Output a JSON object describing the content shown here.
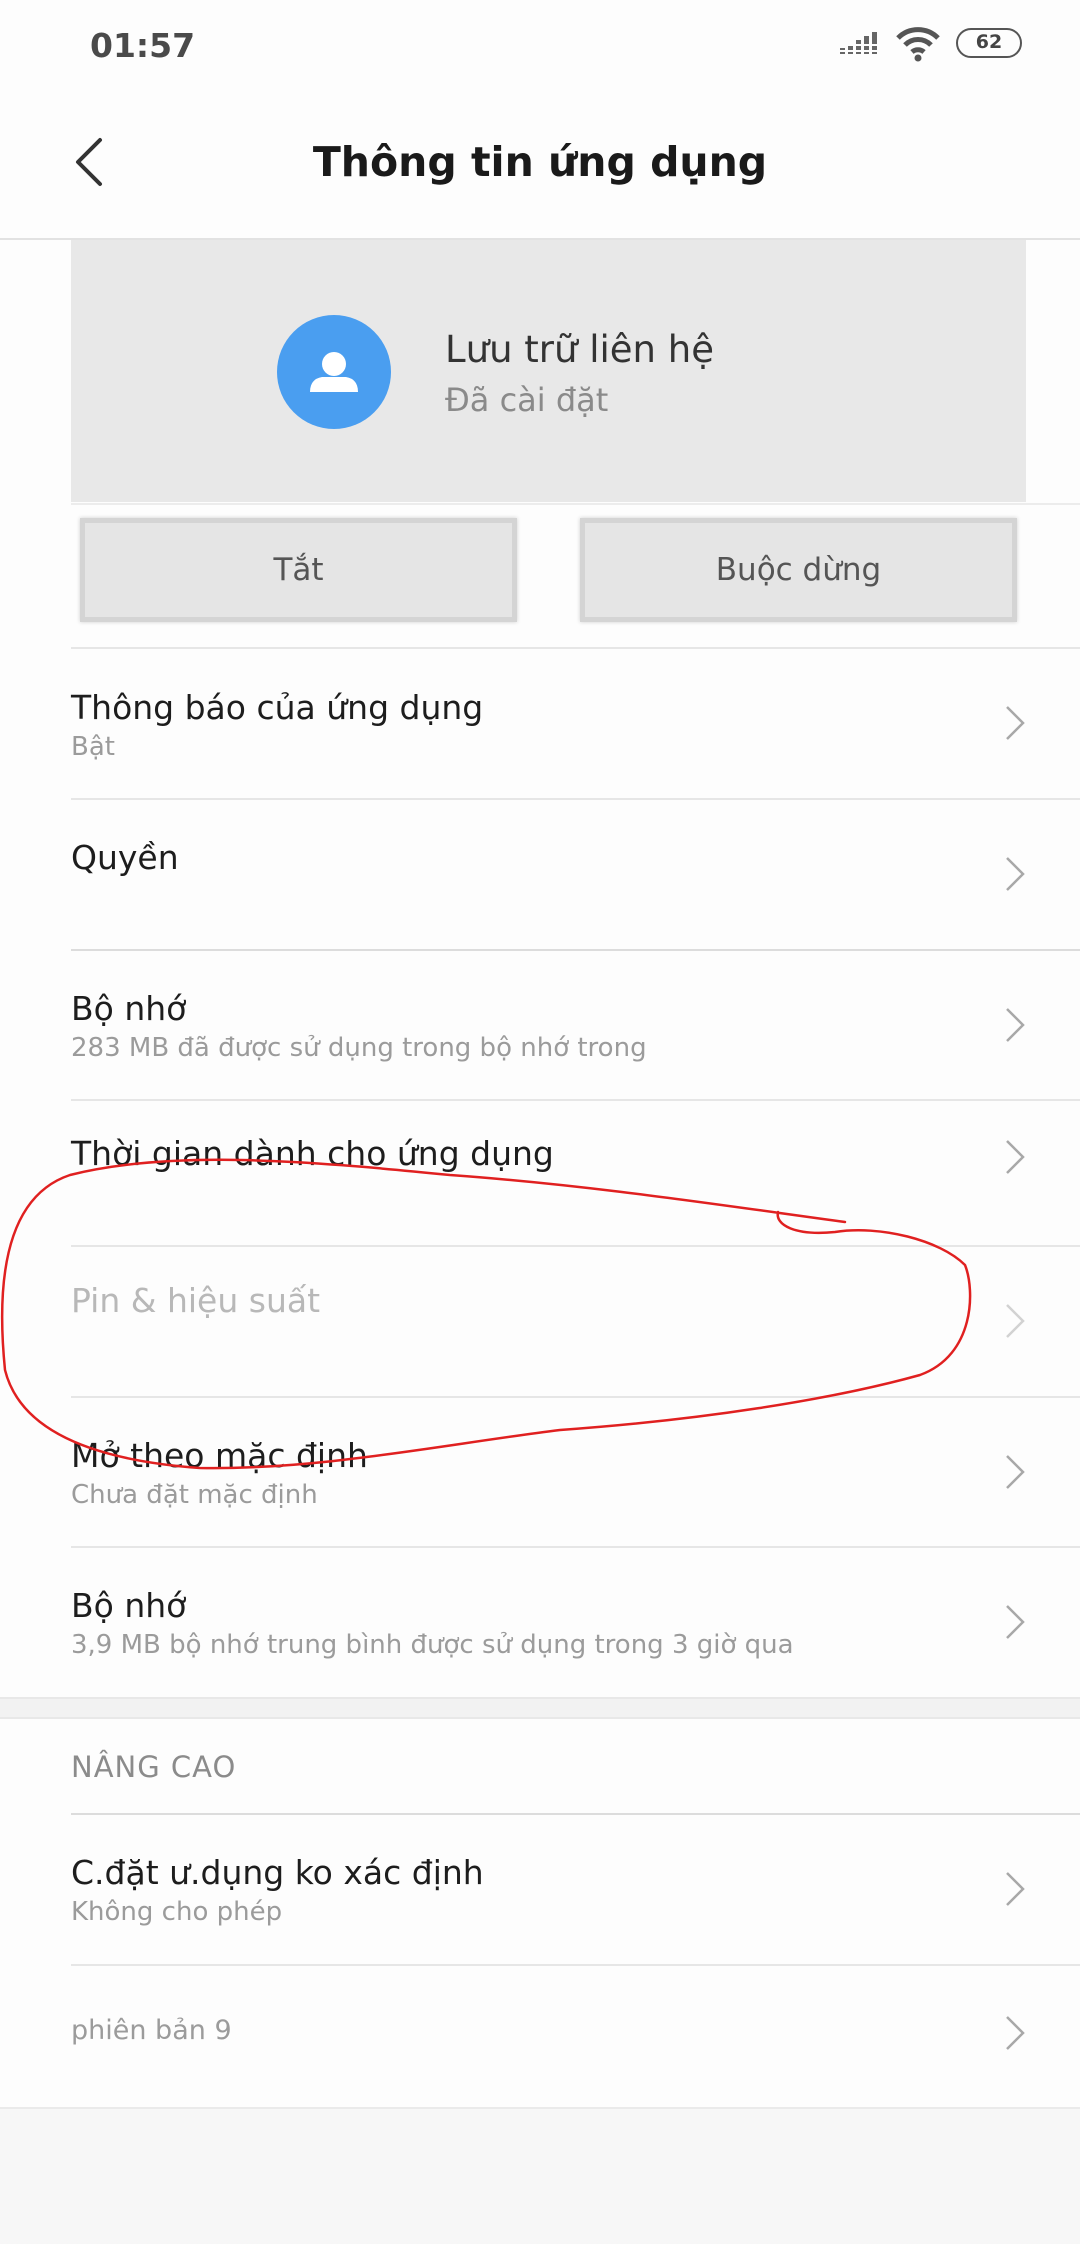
{
  "status_bar": {
    "time": "01:57",
    "battery": "62",
    "icons": [
      "signal-icon",
      "wifi-icon",
      "battery-icon"
    ]
  },
  "header": {
    "title": "Thông tin ứng dụng",
    "back_icon": "back-arrow-icon"
  },
  "app": {
    "name": "Lưu trữ liên hệ",
    "status": "Đã cài đặt",
    "icon": "contact-person-icon",
    "icon_color": "#4a9ef0"
  },
  "buttons": {
    "disable": "Tắt",
    "force_stop": "Buộc dừng"
  },
  "settings": [
    {
      "title": "Thông báo của ứng dụng",
      "subtitle": "Bật"
    },
    {
      "title": "Quyền",
      "subtitle": ""
    },
    {
      "title": "Bộ nhớ",
      "subtitle": "283 MB đã được sử dụng trong bộ nhớ trong"
    },
    {
      "title": "Thời gian dành cho ứng dụng",
      "subtitle": ""
    },
    {
      "title": "Pin & hiệu suất",
      "subtitle": ""
    },
    {
      "title": "Mở theo mặc định",
      "subtitle": "Chưa đặt mặc định"
    },
    {
      "title": "Bộ nhớ",
      "subtitle": "3,9 MB bộ nhớ trung bình được sử dụng trong 3 giờ qua"
    }
  ],
  "advanced": {
    "header": "NÂNG CAO",
    "items": [
      {
        "title": "C.đặt ư.dụng ko xác định",
        "subtitle": "Không cho phép"
      },
      {
        "title": "phiên bản 9"
      }
    ]
  },
  "annotation": {
    "shape": "hand-drawn-red-ellipse",
    "color": "#e02020"
  }
}
